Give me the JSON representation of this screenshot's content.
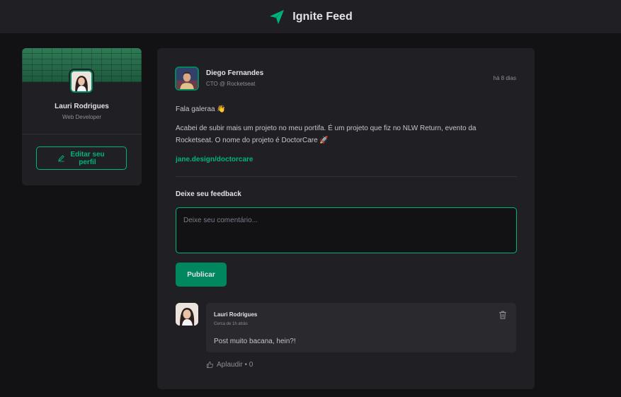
{
  "header": {
    "title": "Ignite Feed",
    "logo_icon": "paper-plane-icon",
    "accent": "#00b37e"
  },
  "sidebar": {
    "name": "Lauri Rodrigues",
    "role": "Web Developer",
    "edit_label": "Editar seu perfil",
    "edit_icon": "pencil-icon"
  },
  "post": {
    "author": {
      "name": "Diego Fernandes",
      "role": "CTO @ Rocketseat"
    },
    "time": "há 8 dias",
    "paragraphs": [
      "Fala galeraa 👋",
      "Acabei de subir mais um projeto no meu portifa. É um projeto que fiz no NLW Return, evento da Rocketseat. O nome do projeto é DoctorCare 🚀"
    ],
    "link": "jane.design/doctorcare"
  },
  "feedback": {
    "label": "Deixe seu feedback",
    "placeholder": "Deixe seu comentário...",
    "publish_label": "Publicar"
  },
  "comment": {
    "author": "Lauri Rodrigues",
    "time": "Cerca de 1h atrás",
    "text": "Post muito bacana, hein?!",
    "delete_icon": "trash-icon",
    "applaud_label": "Aplaudir • 0"
  }
}
